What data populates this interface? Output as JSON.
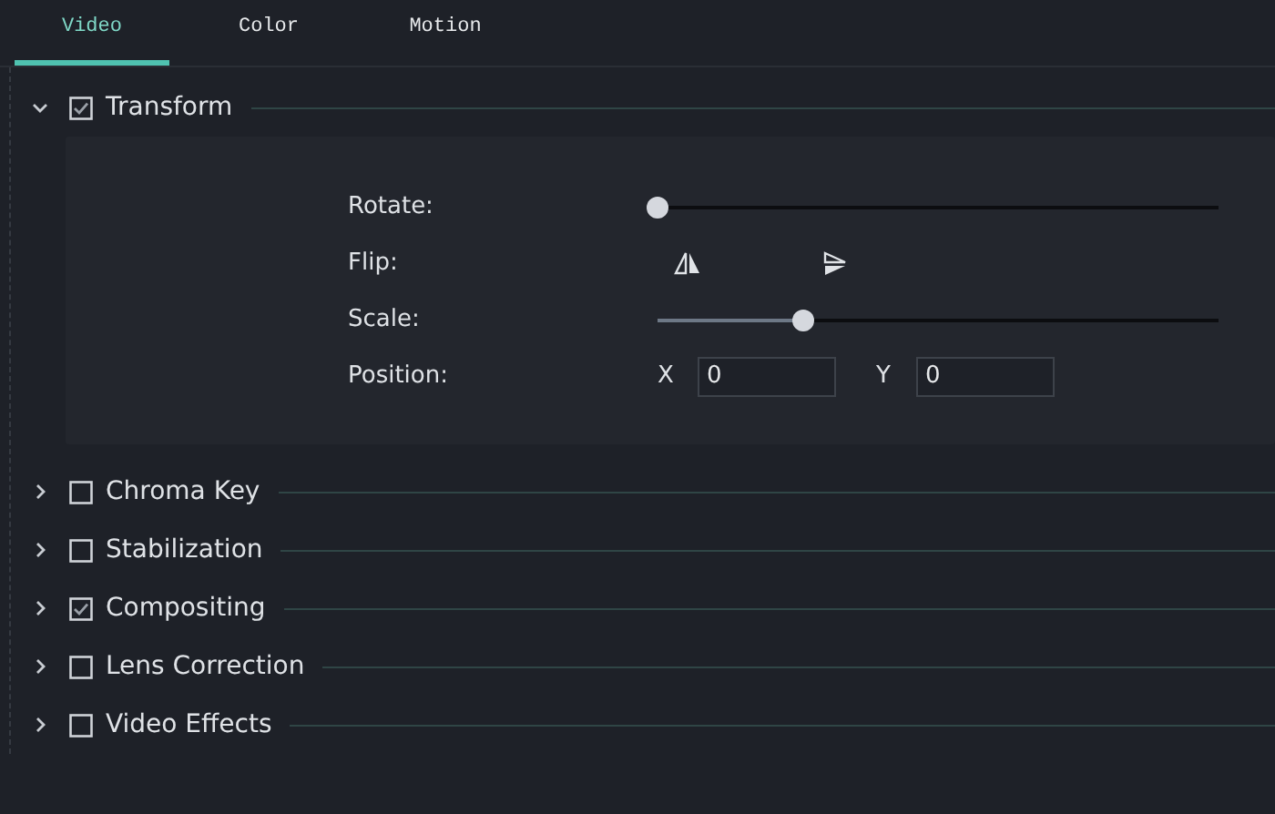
{
  "tabs": [
    {
      "label": "Video",
      "selected": true
    },
    {
      "label": "Color",
      "selected": false
    },
    {
      "label": "Motion",
      "selected": false
    }
  ],
  "sections": [
    {
      "title": "Transform",
      "checked": true,
      "expanded": true,
      "controls": [
        {
          "kind": "slider",
          "label": "Rotate:",
          "level": 0
        },
        {
          "kind": "flip",
          "label": "Flip:"
        },
        {
          "kind": "slider",
          "label": "Scale:",
          "level": 0.26
        },
        {
          "kind": "position",
          "label": "Position:",
          "x_label": "X",
          "x_value": "0",
          "y_label": "Y",
          "y_value": "0"
        }
      ]
    },
    {
      "title": "Chroma Key",
      "checked": false,
      "expanded": false
    },
    {
      "title": "Stabilization",
      "checked": false,
      "expanded": false
    },
    {
      "title": "Compositing",
      "checked": true,
      "expanded": false
    },
    {
      "title": "Lens Correction",
      "checked": false,
      "expanded": false
    },
    {
      "title": "Video Effects",
      "checked": false,
      "expanded": false
    }
  ]
}
